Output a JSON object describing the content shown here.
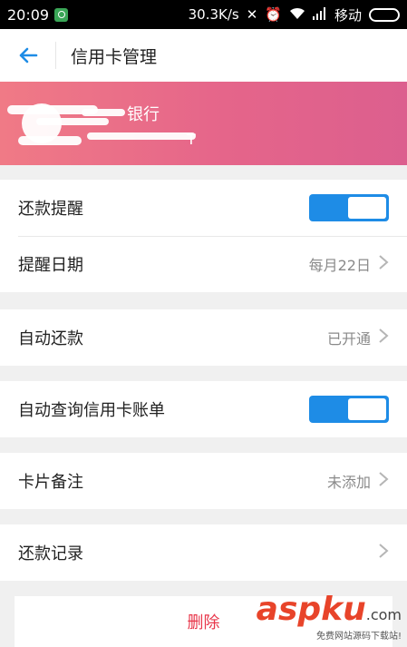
{
  "status_bar": {
    "time": "20:09",
    "speed": "30.3K/s",
    "carrier": "移动"
  },
  "header": {
    "title": "信用卡管理"
  },
  "card": {
    "bank_name": "银行",
    "card_sub": "T"
  },
  "rows": {
    "repay_reminder": {
      "label": "还款提醒",
      "toggle_on": true
    },
    "reminder_date": {
      "label": "提醒日期",
      "value": "每月22日"
    },
    "auto_repay": {
      "label": "自动还款",
      "value": "已开通"
    },
    "auto_query": {
      "label": "自动查询信用卡账单",
      "toggle_on": true
    },
    "card_note": {
      "label": "卡片备注",
      "value": "未添加"
    },
    "repay_record": {
      "label": "还款记录"
    }
  },
  "actions": {
    "delete_label": "删除"
  },
  "watermark": {
    "main_a": "asp",
    "main_b": "ku",
    "main_c": ".com",
    "sub": "免费网站源码下载站!"
  },
  "colors": {
    "accent_blue": "#1e8ce6",
    "delete_red": "#e8364a",
    "banner_start": "#f07a86",
    "banner_end": "#dc5f8e"
  }
}
